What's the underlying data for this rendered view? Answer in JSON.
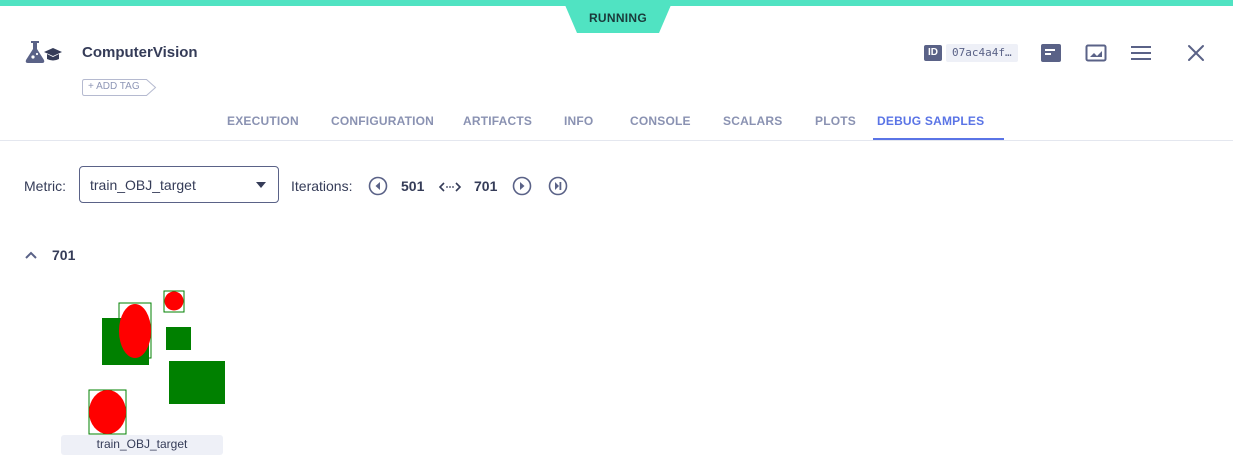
{
  "status": {
    "label": "RUNNING",
    "color": "#50e3c2"
  },
  "header": {
    "project_name": "ComputerVision",
    "add_tag_label": "ADD TAG",
    "id_badge": "ID",
    "id_value": "07ac4a4f…",
    "icons": [
      "info-panel-icon",
      "chart-panel-icon",
      "menu-icon",
      "close-icon"
    ]
  },
  "tabs": [
    {
      "label": "EXECUTION",
      "active": false
    },
    {
      "label": "CONFIGURATION",
      "active": false
    },
    {
      "label": "ARTIFACTS",
      "active": false
    },
    {
      "label": "INFO",
      "active": false
    },
    {
      "label": "CONSOLE",
      "active": false
    },
    {
      "label": "SCALARS",
      "active": false
    },
    {
      "label": "PLOTS",
      "active": false
    },
    {
      "label": "DEBUG SAMPLES",
      "active": true
    }
  ],
  "controls": {
    "metric_label": "Metric:",
    "metric_value": "train_OBJ_target",
    "iterations_label": "Iterations:",
    "iteration_start": "501",
    "iteration_end": "701"
  },
  "samples": {
    "group_title": "701",
    "items": [
      {
        "caption": "train_OBJ_target"
      }
    ]
  },
  "colors": {
    "accent": "#5a74e6",
    "text": "#353c58",
    "muted": "#8a92b2"
  }
}
